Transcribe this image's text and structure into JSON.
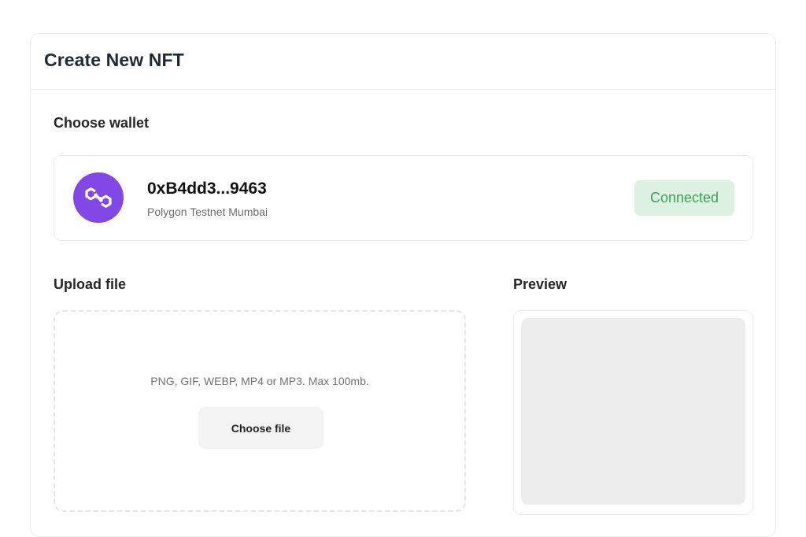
{
  "page": {
    "title": "Create New NFT"
  },
  "wallet_section": {
    "label": "Choose wallet",
    "wallet": {
      "icon": "polygon-logo-icon",
      "address": "0xB4dd3...9463",
      "network": "Polygon Testnet Mumbai",
      "status": "Connected",
      "brand_color": "#8247e5",
      "status_bg": "#dcf1e2",
      "status_color": "#3aa157"
    }
  },
  "upload_section": {
    "label": "Upload file",
    "hint": "PNG, GIF, WEBP, MP4 or MP3. Max 100mb.",
    "button_label": "Choose file"
  },
  "preview_section": {
    "label": "Preview"
  }
}
